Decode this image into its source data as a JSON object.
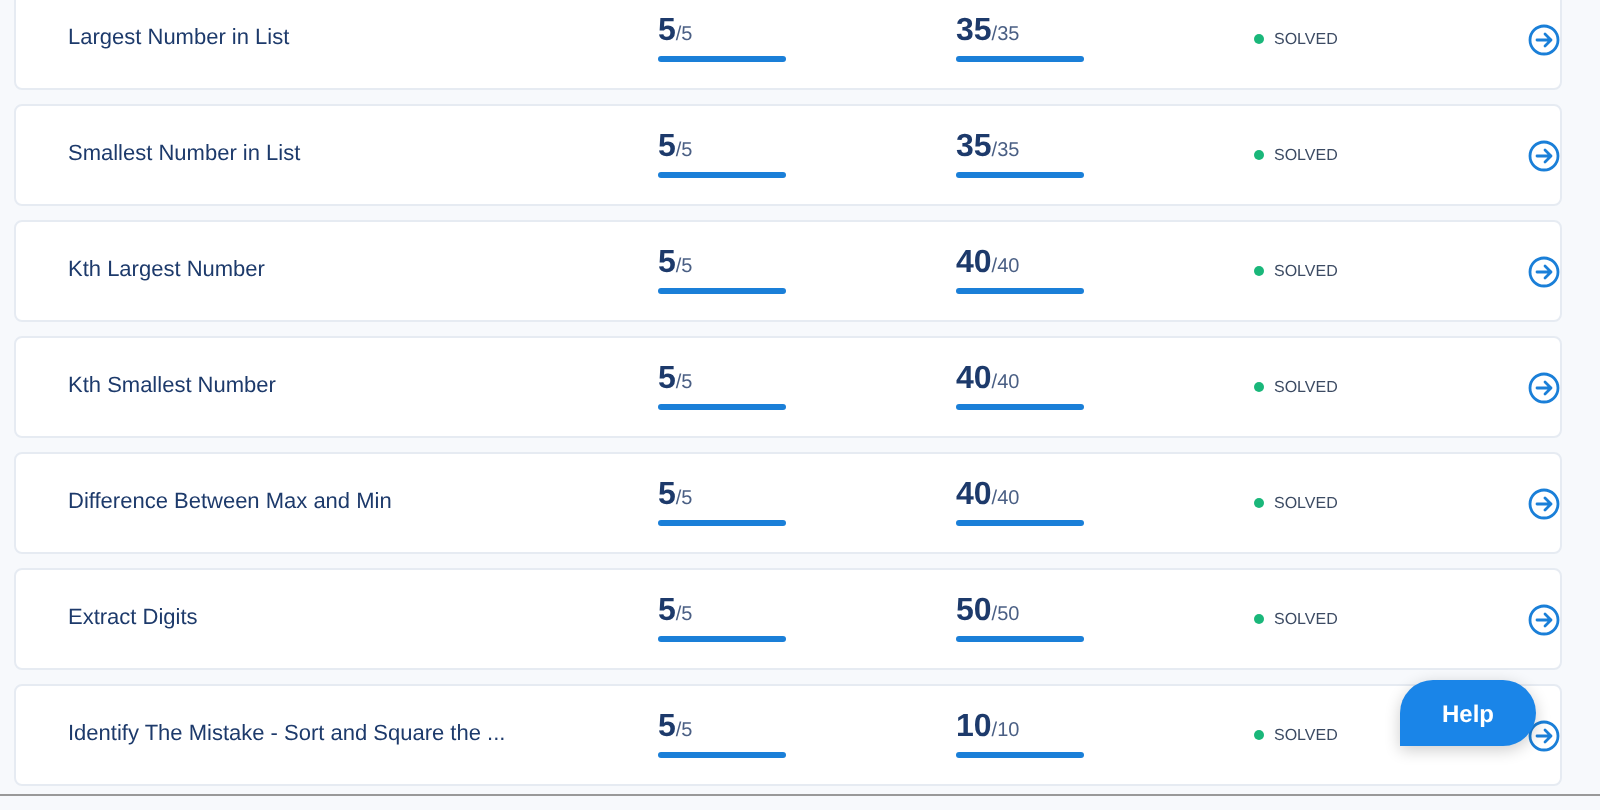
{
  "problems": [
    {
      "title": "Largest Number in List",
      "score": "5",
      "score_max": "/5",
      "points": "35",
      "points_max": "/35",
      "status": "SOLVED"
    },
    {
      "title": "Smallest Number in List",
      "score": "5",
      "score_max": "/5",
      "points": "35",
      "points_max": "/35",
      "status": "SOLVED"
    },
    {
      "title": "Kth Largest Number",
      "score": "5",
      "score_max": "/5",
      "points": "40",
      "points_max": "/40",
      "status": "SOLVED"
    },
    {
      "title": "Kth Smallest Number",
      "score": "5",
      "score_max": "/5",
      "points": "40",
      "points_max": "/40",
      "status": "SOLVED"
    },
    {
      "title": "Difference Between Max and Min",
      "score": "5",
      "score_max": "/5",
      "points": "40",
      "points_max": "/40",
      "status": "SOLVED"
    },
    {
      "title": "Extract Digits",
      "score": "5",
      "score_max": "/5",
      "points": "50",
      "points_max": "/50",
      "status": "SOLVED"
    },
    {
      "title": "Identify The Mistake - Sort and Square the ...",
      "score": "5",
      "score_max": "/5",
      "points": "10",
      "points_max": "/10",
      "status": "SOLVED"
    }
  ],
  "help_button": {
    "label": "Help"
  }
}
